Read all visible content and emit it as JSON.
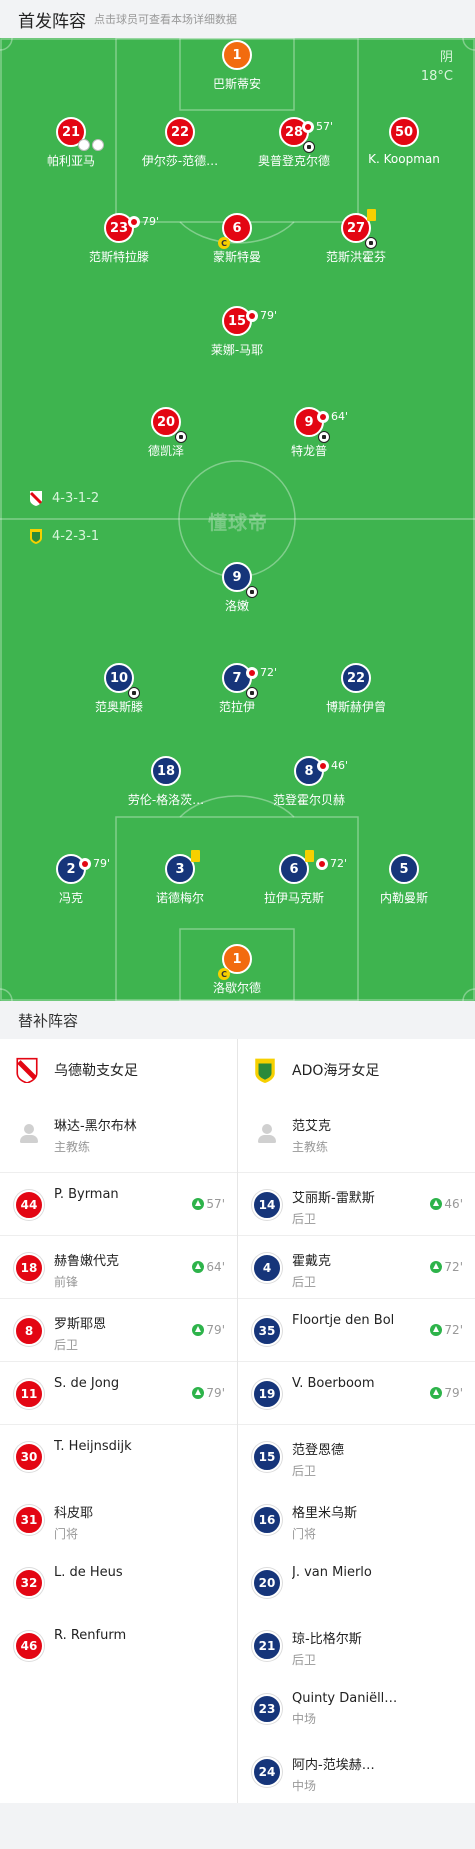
{
  "header": {
    "title": "首发阵容",
    "subtitle": "点击球员可查看本场详细数据"
  },
  "weather": {
    "condition": "阴",
    "temp": "18°C"
  },
  "watermark": "懂球帝",
  "formations": {
    "home": "4-3-1-2",
    "away": "4-2-3-1"
  },
  "home_lineup": [
    {
      "num": "1",
      "name": "巴斯蒂安",
      "gk": true
    },
    {
      "num": "21",
      "name": "帕利亚马"
    },
    {
      "num": "22",
      "name": "伊尔莎-范德…"
    },
    {
      "num": "28",
      "name": "奥普登克尔德",
      "sub_min": "57'"
    },
    {
      "num": "50",
      "name": "K. Koopman"
    },
    {
      "num": "23",
      "name": "范斯特拉滕",
      "sub_min": "79'"
    },
    {
      "num": "6",
      "name": "蒙斯特曼"
    },
    {
      "num": "27",
      "name": "范斯洪霍芬"
    },
    {
      "num": "15",
      "name": "莱娜-马耶",
      "sub_min": "79'"
    },
    {
      "num": "20",
      "name": "德凯泽"
    },
    {
      "num": "9",
      "name": "特龙普",
      "sub_min": "64'"
    }
  ],
  "away_lineup": [
    {
      "num": "9",
      "name": "洛嫩"
    },
    {
      "num": "10",
      "name": "范奥斯滕"
    },
    {
      "num": "7",
      "name": "范拉伊",
      "sub_min": "72'"
    },
    {
      "num": "22",
      "name": "博斯赫伊曾"
    },
    {
      "num": "18",
      "name": "劳伦-格洛茨…"
    },
    {
      "num": "8",
      "name": "范登霍尔贝赫",
      "sub_min": "46'"
    },
    {
      "num": "2",
      "name": "冯克",
      "sub_min": "79'"
    },
    {
      "num": "3",
      "name": "诺德梅尔"
    },
    {
      "num": "6",
      "name": "拉伊马克斯",
      "sub_min": "72'"
    },
    {
      "num": "5",
      "name": "内勒曼斯"
    },
    {
      "num": "1",
      "name": "洛歇尔德",
      "gk": true
    }
  ],
  "captain_mark": "C",
  "bench_title": "替补阵容",
  "home_team": {
    "name": "乌德勒支女足"
  },
  "away_team": {
    "name": "ADO海牙女足"
  },
  "home_coach": {
    "name": "琳达-黑尔布林",
    "role": "主教练"
  },
  "away_coach": {
    "name": "范艾克",
    "role": "主教练"
  },
  "home_subs": [
    {
      "num": "44",
      "name": "P. Byrman",
      "pos": "",
      "min": "57'"
    },
    {
      "num": "18",
      "name": "赫鲁嫩代克",
      "pos": "前锋",
      "min": "64'"
    },
    {
      "num": "8",
      "name": "罗斯耶恩",
      "pos": "后卫",
      "min": "79'"
    },
    {
      "num": "11",
      "name": "S. de Jong",
      "pos": "",
      "min": "79'"
    },
    {
      "num": "30",
      "name": "T. Heijnsdijk",
      "pos": "",
      "min": ""
    },
    {
      "num": "31",
      "name": "科皮耶",
      "pos": "门将",
      "min": ""
    },
    {
      "num": "32",
      "name": "L. de Heus",
      "pos": "",
      "min": ""
    },
    {
      "num": "46",
      "name": "R. Renfurm",
      "pos": "",
      "min": ""
    }
  ],
  "away_subs": [
    {
      "num": "14",
      "name": "艾丽斯-雷默斯",
      "pos": "后卫",
      "min": "46'"
    },
    {
      "num": "4",
      "name": "霍戴克",
      "pos": "后卫",
      "min": "72'"
    },
    {
      "num": "35",
      "name": "Floortje den Bol",
      "pos": "",
      "min": "72'"
    },
    {
      "num": "19",
      "name": "V. Boerboom",
      "pos": "",
      "min": "79'"
    },
    {
      "num": "15",
      "name": "范登恩德",
      "pos": "后卫",
      "min": ""
    },
    {
      "num": "16",
      "name": "格里米乌斯",
      "pos": "门将",
      "min": ""
    },
    {
      "num": "20",
      "name": "J. van Mierlo",
      "pos": "",
      "min": ""
    },
    {
      "num": "21",
      "name": "琼-比格尔斯",
      "pos": "后卫",
      "min": ""
    },
    {
      "num": "23",
      "name": "Quinty Daniëll…",
      "pos": "中场",
      "min": ""
    },
    {
      "num": "24",
      "name": "阿内-范埃赫…",
      "pos": "中场",
      "min": ""
    }
  ],
  "colors": {
    "pitch": "#3eb44f",
    "home": "#e30613",
    "away": "#16357a",
    "gk_home": "#f26b0f"
  }
}
